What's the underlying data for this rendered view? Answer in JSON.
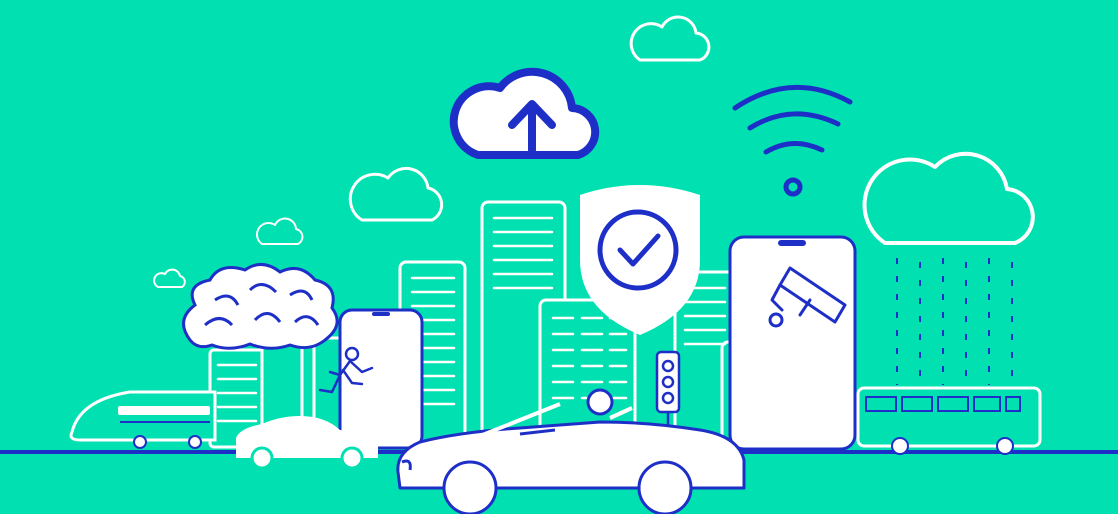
{
  "scene": {
    "colors": {
      "background": "#00E0B0",
      "line_white": "#FFFFFF",
      "line_blue": "#1E2FC8",
      "ground": "#1E2FC8"
    },
    "elements": [
      {
        "name": "cloud-upload-icon",
        "kind": "icon"
      },
      {
        "name": "wifi-icon",
        "kind": "icon"
      },
      {
        "name": "security-shield-check-icon",
        "kind": "icon"
      },
      {
        "name": "rain-cloud",
        "kind": "illustration"
      },
      {
        "name": "brain-icon",
        "kind": "illustration"
      },
      {
        "name": "smartphone-running-person",
        "kind": "illustration"
      },
      {
        "name": "smartphone-cctv-camera",
        "kind": "illustration"
      },
      {
        "name": "traffic-light-icon",
        "kind": "icon"
      },
      {
        "name": "high-speed-train",
        "kind": "vehicle"
      },
      {
        "name": "city-bus",
        "kind": "vehicle"
      },
      {
        "name": "white-car",
        "kind": "vehicle"
      },
      {
        "name": "convertible-car-with-driver",
        "kind": "vehicle"
      },
      {
        "name": "city-skyline",
        "kind": "illustration"
      }
    ]
  }
}
